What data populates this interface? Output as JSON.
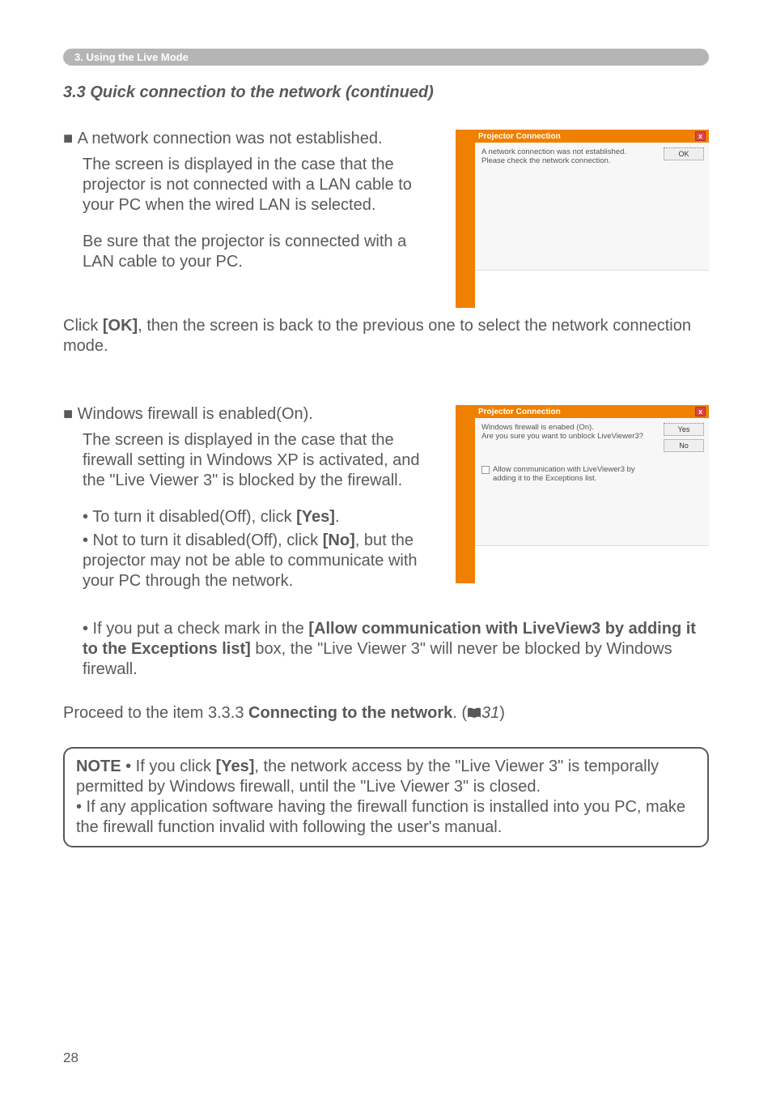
{
  "breadcrumb": "3. Using the Live Mode",
  "section_title": "3.3 Quick connection to the network (continued)",
  "block1": {
    "heading_prefix": "■ ",
    "heading": "A network connection was not established.",
    "p1": "The screen is displayed in the case that the projector is not connected with a LAN cable to your PC when the wired LAN is selected.",
    "p2": "Be sure that the projector is connected with a LAN cable to your PC."
  },
  "dialog1": {
    "title": "Projector Connection",
    "line1": "A network connection was not established.",
    "line2": "Please check the network connection.",
    "ok": "OK"
  },
  "after1_a": "Click ",
  "after1_b": "[OK]",
  "after1_c": ", then the screen is back to the previous one to select the network connection mode.",
  "block2": {
    "heading_prefix": "■ ",
    "heading": "Windows firewall is enabled(On).",
    "p1": "The screen is displayed in the case that the firewall setting in Windows XP is activated, and the \"Live Viewer 3\" is blocked by the firewall.",
    "li1_a": "• To turn it disabled(Off), click ",
    "li1_b": "[Yes]",
    "li1_c": ".",
    "li2_a": "• Not to turn it disabled(Off), click ",
    "li2_b": "[No]",
    "li2_c": ", but the projector may not be able to communicate with your PC through the network.",
    "li3_a": "• If you put a check mark in the ",
    "li3_b": "[Allow communication with LiveView3 by adding it to the Exceptions list]",
    "li3_c": " box, the \"Live Viewer 3\" will never be blocked by Windows firewall."
  },
  "dialog2": {
    "title": "Projector Connection",
    "line1": "Windows firewall is enabed (On).",
    "line2": "Are you sure you want to unblock LiveViewer3?",
    "checkbox_text": "Allow communication with LiveViewer3 by adding it to the Exceptions list.",
    "yes": "Yes",
    "no": "No"
  },
  "proceed_a": "Proceed to the item 3.3.3 ",
  "proceed_b": "Connecting to the network",
  "proceed_c": ". (",
  "proceed_page": "31",
  "proceed_d": ")",
  "note": {
    "label": "NOTE",
    "l1_a": "  • If you click ",
    "l1_b": "[Yes]",
    "l1_c": ", the network access by the \"Live Viewer 3\" is temporally permitted by Windows firewall, until the \"Live Viewer 3\" is closed.",
    "l2": "• If any application software having the firewall function is installed into you PC, make the firewall function invalid with following the user's manual."
  },
  "pagenum": "28"
}
